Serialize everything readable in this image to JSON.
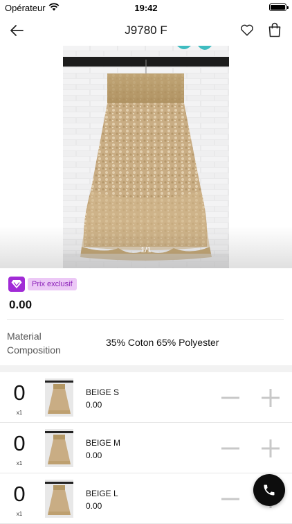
{
  "status_bar": {
    "carrier": "Opérateur",
    "time": "19:42",
    "wifi_icon": "wifi-icon",
    "battery_icon": "battery-icon"
  },
  "nav": {
    "title": "J9780 F",
    "back_icon": "arrow-left-icon",
    "favorite_icon": "heart-icon",
    "cart_icon": "shopping-bag-icon"
  },
  "gallery": {
    "pager": "1/1",
    "image_subject": "beige lace skirt"
  },
  "product": {
    "badge_label": "Prix exclusif",
    "badge_icon": "diamond-icon",
    "price": "0.00",
    "material_label": "Material Composition",
    "material_value": "35% Coton 65% Polyester"
  },
  "variants": [
    {
      "qty": "0",
      "multiplier": "x1",
      "name": "BEIGE S",
      "price": "0.00"
    },
    {
      "qty": "0",
      "multiplier": "x1",
      "name": "BEIGE M",
      "price": "0.00"
    },
    {
      "qty": "0",
      "multiplier": "x1",
      "name": "BEIGE L",
      "price": "0.00"
    }
  ],
  "fab": {
    "icon": "phone-icon"
  },
  "colors": {
    "accent_purple": "#a12bd6",
    "badge_bg": "#ecc8f6",
    "badge_text": "#8a1fb8",
    "stepper_gray": "#c8c8c8",
    "fab_bg": "#0d0d0d"
  }
}
